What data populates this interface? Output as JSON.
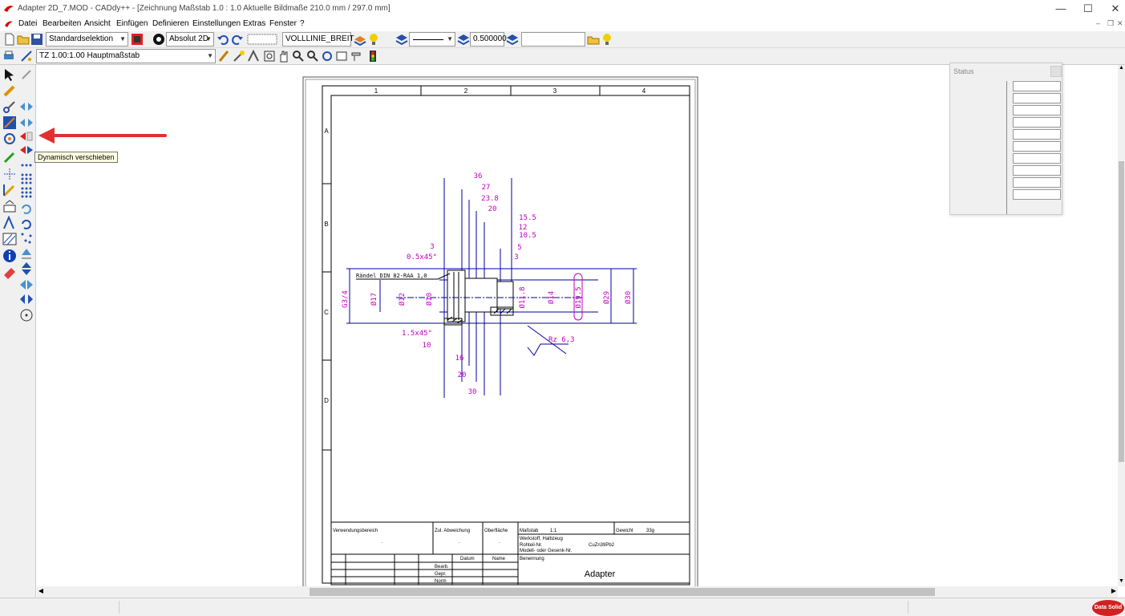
{
  "window": {
    "title": "Adapter 2D_7.MOD  -  CADdy++ - [Zeichnung   Maßstab 1.0 : 1.0   Aktuelle Bildmaße 210.0 mm / 297.0 mm]",
    "minimize": "—",
    "maximize": "☐",
    "close": "✕"
  },
  "menu": {
    "items": [
      "Datei",
      "Bearbeiten",
      "Ansicht",
      "Einfügen",
      "Definieren",
      "Einstellungen",
      "Extras",
      "Fenster",
      "?"
    ],
    "mdi_minimize": "–",
    "mdi_restore": "❐",
    "mdi_close": "✕"
  },
  "toolbar1": {
    "selection_mode": "Standardselektion",
    "coord_mode": "Absolut 2D",
    "line_type": "VOLLLINIE_BREIT",
    "line_width": "0.500000",
    "extra_field": ""
  },
  "toolbar2": {
    "scale": "TZ 1.00:1.00 Hauptmaßstab"
  },
  "tooltip": "Dynamisch verschieben",
  "status_panel": {
    "title": "Status",
    "rows": 10
  },
  "drawing": {
    "column_labels": [
      "1",
      "2",
      "3",
      "4"
    ],
    "row_labels": [
      "A",
      "B",
      "C",
      "D"
    ],
    "dimensions": [
      "36",
      "27",
      "23.8",
      "20",
      "15.5",
      "12",
      "10.5",
      "5",
      "3",
      "3",
      "0.5x45°",
      "1.5x45°",
      "10",
      "16",
      "20",
      "30"
    ],
    "diameters": [
      "G3/4",
      "Ø17",
      "Ø12",
      "Ø10",
      "Ø11.8",
      "Ø14",
      "Ø19.5",
      "Ø29",
      "Ø30"
    ],
    "knurl_note": "Rändel DIN 82-RAA 1,0",
    "surface": "Rz 6,3",
    "title_block": {
      "usage": "Verwendungsbereich",
      "tolerance": "Zul. Abweichung",
      "surface": "Oberfläche",
      "scale_label": "Maßstab",
      "scale_value": "1:1",
      "weight_label": "Gewicht",
      "weight_value": "33g",
      "material_label": "Werkstoff, Halbzeug",
      "blank_label": "Rohteil-Nr.",
      "material_value": "CuZn39Pb2",
      "model_label": "Modell- oder Gesenk-Nr.",
      "date_label": "Datum",
      "name_label": "Name",
      "edited": "Bearb.",
      "checked": "Gepr.",
      "norm": "Norm",
      "designation_label": "Benennung",
      "designation": "Adapter",
      "dot1": ".",
      "dot2": ".",
      "dot3": "."
    }
  },
  "brand": "Data Solid",
  "colors": {
    "dimension": "#c000c0",
    "geometry": "#0000a0",
    "arrow": "#e03030"
  }
}
